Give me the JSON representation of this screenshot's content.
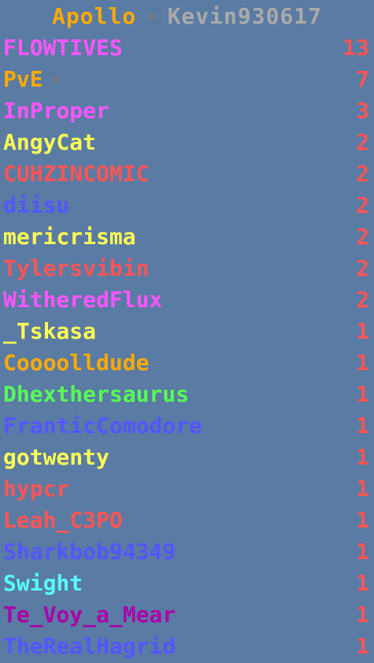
{
  "header": {
    "server": "Apollo",
    "separator": "»",
    "player": "Kevin930617",
    "colors": {
      "server": "#ffaa00",
      "player": "#aaaaaa"
    }
  },
  "rows": [
    {
      "name": "FLOWTIVES",
      "suffix": "",
      "score": "13",
      "color": "#ff55ff"
    },
    {
      "name": "PvE",
      "suffix": "»",
      "score": "7",
      "color": "#ffaa00"
    },
    {
      "name": "InProper",
      "suffix": "",
      "score": "3",
      "color": "#ff55ff"
    },
    {
      "name": "AngyCat",
      "suffix": "",
      "score": "2",
      "color": "#ffff55"
    },
    {
      "name": "CUHZINCOMIC",
      "suffix": "",
      "score": "2",
      "color": "#ff5555"
    },
    {
      "name": "diisu",
      "suffix": "",
      "score": "2",
      "color": "#5555ff"
    },
    {
      "name": "mericrisma",
      "suffix": "",
      "score": "2",
      "color": "#ffff55"
    },
    {
      "name": "Tylersvibin",
      "suffix": "",
      "score": "2",
      "color": "#ff5555"
    },
    {
      "name": "WitheredFlux",
      "suffix": "",
      "score": "2",
      "color": "#ff55ff"
    },
    {
      "name": "_Tskasa",
      "suffix": "",
      "score": "1",
      "color": "#ffff55"
    },
    {
      "name": "Coooolldude",
      "suffix": "",
      "score": "1",
      "color": "#ffaa00"
    },
    {
      "name": "Dhexthersaurus",
      "suffix": "",
      "score": "1",
      "color": "#55ff55"
    },
    {
      "name": "FranticComodore",
      "suffix": "",
      "score": "1",
      "color": "#5555ff"
    },
    {
      "name": "gotwenty",
      "suffix": "",
      "score": "1",
      "color": "#ffff55"
    },
    {
      "name": "hypcr",
      "suffix": "",
      "score": "1",
      "color": "#ff5555"
    },
    {
      "name": "Leah_C3PO",
      "suffix": "",
      "score": "1",
      "color": "#ff5555"
    },
    {
      "name": "Sharkbob94349",
      "suffix": "",
      "score": "1",
      "color": "#5555ff"
    },
    {
      "name": "Swight",
      "suffix": "",
      "score": "1",
      "color": "#55ffff"
    },
    {
      "name": "Te_Voy_a_Mear",
      "suffix": "",
      "score": "1",
      "color": "#aa00aa"
    },
    {
      "name": "TheRealHagrid",
      "suffix": "",
      "score": "1",
      "color": "#5555ff"
    }
  ]
}
